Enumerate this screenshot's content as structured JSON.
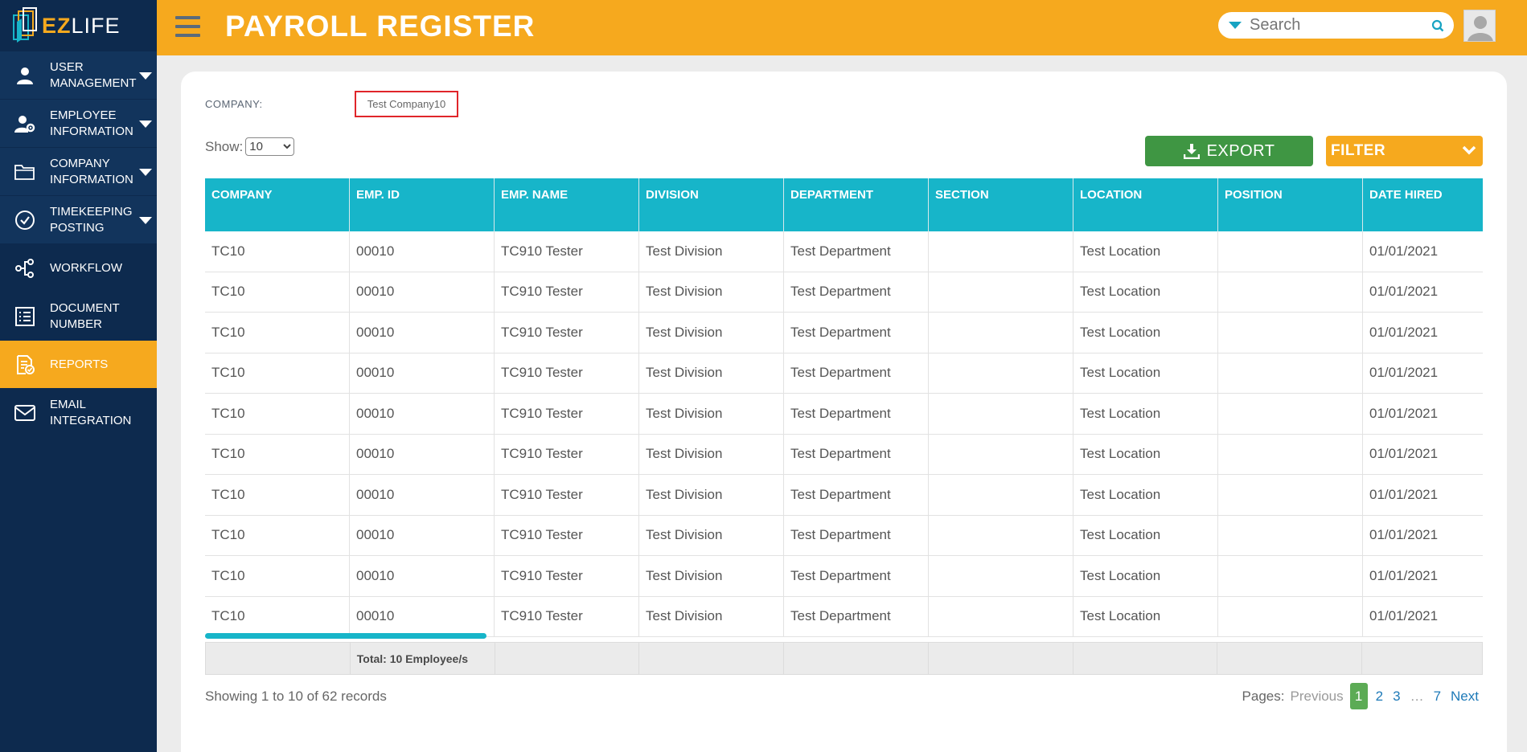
{
  "app": {
    "logo_ez": "EZ",
    "logo_life": "LIFE",
    "page_title": "PAYROLL REGISTER",
    "accent_color": "#f6a91e",
    "sidebar_color": "#0d2a4e",
    "table_header_color": "#17b5c9"
  },
  "search": {
    "placeholder": "Search"
  },
  "sidebar": {
    "items": [
      {
        "label": "USER MANAGEMENT",
        "icon": "user-icon",
        "has_caret": true
      },
      {
        "label": "EMPLOYEE INFORMATION",
        "icon": "user-gear-icon",
        "has_caret": true
      },
      {
        "label": "COMPANY INFORMATION",
        "icon": "folder-icon",
        "has_caret": true
      },
      {
        "label": "TIMEKEEPING POSTING",
        "icon": "check-circle-icon",
        "has_caret": true
      },
      {
        "label": "WORKFLOW",
        "icon": "workflow-icon",
        "has_caret": false
      },
      {
        "label": "DOCUMENT NUMBER",
        "icon": "document-list-icon",
        "has_caret": false
      },
      {
        "label": "REPORTS",
        "icon": "report-icon",
        "has_caret": false,
        "active": true
      },
      {
        "label": "EMAIL INTEGRATION",
        "icon": "mail-icon",
        "has_caret": false
      }
    ]
  },
  "filters": {
    "company_label": "COMPANY:",
    "company_value": "Test Company10",
    "show_label": "Show:",
    "show_value": "10",
    "export_label": "EXPORT",
    "filter_label": "FILTER"
  },
  "table": {
    "columns": [
      "COMPANY",
      "EMP. ID",
      "EMP. NAME",
      "DIVISION",
      "DEPARTMENT",
      "SECTION",
      "LOCATION",
      "POSITION",
      "DATE HIRED"
    ],
    "rows": [
      [
        "TC10",
        "00010",
        "TC910 Tester",
        "Test Division",
        "Test Department",
        "",
        "Test Location",
        "",
        "01/01/2021"
      ],
      [
        "TC10",
        "00010",
        "TC910 Tester",
        "Test Division",
        "Test Department",
        "",
        "Test Location",
        "",
        "01/01/2021"
      ],
      [
        "TC10",
        "00010",
        "TC910 Tester",
        "Test Division",
        "Test Department",
        "",
        "Test Location",
        "",
        "01/01/2021"
      ],
      [
        "TC10",
        "00010",
        "TC910 Tester",
        "Test Division",
        "Test Department",
        "",
        "Test Location",
        "",
        "01/01/2021"
      ],
      [
        "TC10",
        "00010",
        "TC910 Tester",
        "Test Division",
        "Test Department",
        "",
        "Test Location",
        "",
        "01/01/2021"
      ],
      [
        "TC10",
        "00010",
        "TC910 Tester",
        "Test Division",
        "Test Department",
        "",
        "Test Location",
        "",
        "01/01/2021"
      ],
      [
        "TC10",
        "00010",
        "TC910 Tester",
        "Test Division",
        "Test Department",
        "",
        "Test Location",
        "",
        "01/01/2021"
      ],
      [
        "TC10",
        "00010",
        "TC910 Tester",
        "Test Division",
        "Test Department",
        "",
        "Test Location",
        "",
        "01/01/2021"
      ],
      [
        "TC10",
        "00010",
        "TC910 Tester",
        "Test Division",
        "Test Department",
        "",
        "Test Location",
        "",
        "01/01/2021"
      ],
      [
        "TC10",
        "00010",
        "TC910 Tester",
        "Test Division",
        "Test Department",
        "",
        "Test Location",
        "",
        "01/01/2021"
      ]
    ],
    "total_label": "Total: 10 Employee/s"
  },
  "footer": {
    "showing": "Showing 1 to 10 of 62 records",
    "pages_label": "Pages:",
    "previous": "Previous",
    "pages": [
      "1",
      "2",
      "3"
    ],
    "ellipsis": "…",
    "last_page": "7",
    "next": "Next",
    "current_page": "1"
  }
}
